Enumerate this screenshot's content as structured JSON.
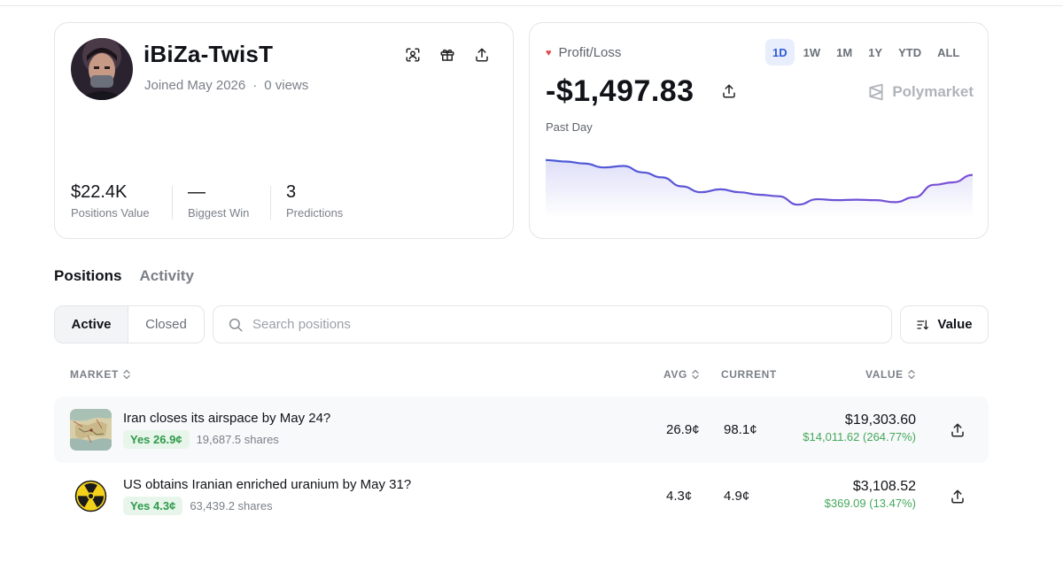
{
  "profile": {
    "username": "iBiZa-TwisT",
    "joined": "Joined May 2026",
    "separator": "·",
    "views": "0 views",
    "icons": [
      "scan-icon",
      "gift-icon",
      "share-icon"
    ],
    "stats": [
      {
        "value": "$22.4K",
        "label": "Positions Value"
      },
      {
        "value": "—",
        "label": "Biggest Win"
      },
      {
        "value": "3",
        "label": "Predictions"
      }
    ]
  },
  "pnl": {
    "label": "Profit/Loss",
    "value": "-$1,497.83",
    "period_label": "Past Day",
    "brand": "Polymarket",
    "ranges": [
      "1D",
      "1W",
      "1M",
      "1Y",
      "YTD",
      "ALL"
    ],
    "active_range": "1D",
    "accent_color": "#5b4fd9"
  },
  "chart_data": {
    "type": "line",
    "title": "",
    "xlabel": "",
    "ylabel": "",
    "values": [
      0.95,
      0.92,
      0.88,
      0.8,
      0.83,
      0.7,
      0.6,
      0.42,
      0.3,
      0.36,
      0.3,
      0.25,
      0.22,
      0.05,
      0.16,
      0.14,
      0.15,
      0.14,
      0.1,
      0.2,
      0.45,
      0.5,
      0.65
    ],
    "ylim": [
      0,
      1
    ],
    "grid": false,
    "legend": "none"
  },
  "tabs": [
    {
      "label": "Positions",
      "active": true
    },
    {
      "label": "Activity",
      "active": false
    }
  ],
  "filter": {
    "active_label": "Active",
    "closed_label": "Closed",
    "search_placeholder": "Search positions",
    "sort_label": "Value"
  },
  "table": {
    "headers": {
      "market": "MARKET",
      "avg": "AVG",
      "current": "CURRENT",
      "value": "VALUE"
    },
    "rows": [
      {
        "title": "Iran closes its airspace by May 24?",
        "outcome": "Yes 26.9¢",
        "shares": "19,687.5 shares",
        "avg": "26.9¢",
        "current": "98.1¢",
        "value": "$19,303.60",
        "pnl": "$14,011.62 (264.77%)",
        "image": "map-image"
      },
      {
        "title": "US obtains Iranian enriched uranium by May 31?",
        "outcome": "Yes 4.3¢",
        "shares": "63,439.2 shares",
        "avg": "4.3¢",
        "current": "4.9¢",
        "value": "$3,108.52",
        "pnl": "$369.09 (13.47%)",
        "image": "radiation-icon"
      }
    ]
  }
}
